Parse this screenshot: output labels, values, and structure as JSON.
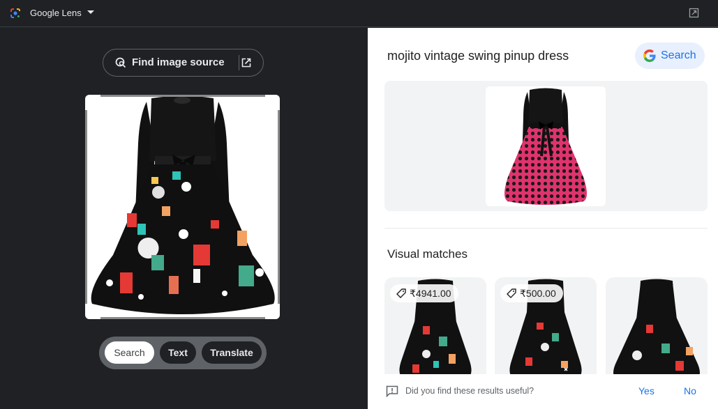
{
  "topbar": {
    "app_title": "Google Lens",
    "logo_icon": "google-lens-icon",
    "menu_icon": "caret-down-icon",
    "open_icon": "open-in-new-tab-icon"
  },
  "left_panel": {
    "find_source": {
      "label": "Find image source",
      "icon": "image-search-icon",
      "ext_icon": "open-in-new-icon"
    },
    "query_image": {
      "alt": "Black long-sleeve Christmas print swing dress"
    },
    "modes": [
      {
        "label": "Search",
        "active": true
      },
      {
        "label": "Text",
        "active": false
      },
      {
        "label": "Translate",
        "active": false
      }
    ]
  },
  "right_panel": {
    "query_title": "mojito vintage swing pinup dress",
    "search_button": "Search",
    "hero_image_alt": "Black and pink polka dot swing dress",
    "visual_matches_title": "Visual matches",
    "matches": [
      {
        "price": "₹4941.00",
        "alt": "Christmas print dress"
      },
      {
        "price": "₹500.00",
        "alt": "Christmas print dress"
      },
      {
        "price": null,
        "alt": "Christmas print dress"
      }
    ],
    "feedback": {
      "question": "Did you find these results useful?",
      "yes": "Yes",
      "no": "No"
    }
  },
  "colors": {
    "accent": "#1a73e8",
    "dark_bg": "#202124",
    "pill_bg": "#e8f0fe",
    "dress_pink": "#e0336e"
  }
}
